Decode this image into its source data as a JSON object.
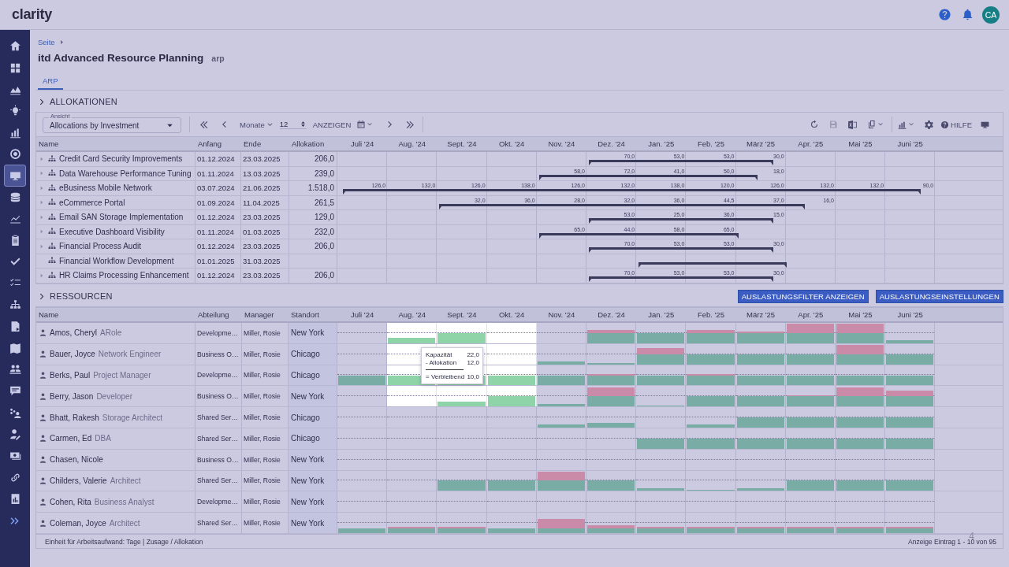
{
  "header": {
    "logo": "clarity",
    "avatar": "CA"
  },
  "sidebar": {
    "items": [
      {
        "selected": false
      },
      {
        "selected": false
      },
      {
        "selected": false
      },
      {
        "selected": false
      },
      {
        "selected": false
      },
      {
        "selected": false
      },
      {
        "selected": true
      },
      {
        "selected": false
      },
      {
        "selected": false
      },
      {
        "selected": false
      },
      {
        "selected": false
      },
      {
        "selected": false
      },
      {
        "selected": false
      },
      {
        "selected": false
      },
      {
        "selected": false
      },
      {
        "selected": false
      },
      {
        "selected": false
      },
      {
        "selected": false
      },
      {
        "selected": false
      },
      {
        "selected": false
      },
      {
        "selected": false
      },
      {
        "selected": false
      },
      {
        "selected": false
      }
    ]
  },
  "breadcrumb": "Seite",
  "title": "itd Advanced Resource Planning",
  "title_tag": "arp",
  "tabs": [
    {
      "label": "ARP",
      "selected": true
    }
  ],
  "allocations": {
    "title": "ALLOKATIONEN",
    "toolbar": {
      "view_label": "Ansicht",
      "view_value": "Allocations by Investment",
      "period": "Monate",
      "count": "12",
      "show": "ANZEIGEN",
      "help": "HILFE"
    },
    "columns": [
      "Name",
      "Anfang",
      "Ende",
      "Allokation"
    ],
    "months": [
      "Juli '24",
      "Aug. '24",
      "Sept. '24",
      "Okt. '24",
      "Nov. '24",
      "Dez. '24",
      "Jan. '25",
      "Feb. '25",
      "März '25",
      "Apr. '25",
      "Mai '25",
      "Juni '25"
    ],
    "rows": [
      {
        "name": "Credit Card Security Improvements",
        "start": "01.12.2024",
        "end": "23.03.2025",
        "allocation": "206,0",
        "expandable": true,
        "values": [
          "70,0",
          "53,0",
          "53,0",
          "30,0"
        ]
      },
      {
        "name": "Data Warehouse Performance Tuning",
        "start": "01.11.2024",
        "end": "13.03.2025",
        "allocation": "239,0",
        "expandable": true,
        "values": [
          "58,0",
          "72,0",
          "41,0",
          "50,0",
          "18,0"
        ]
      },
      {
        "name": "eBusiness Mobile Network",
        "start": "03.07.2024",
        "end": "21.06.2025",
        "allocation": "1.518,0",
        "expandable": true,
        "values": [
          "126,0",
          "132,0",
          "126,0",
          "138,0",
          "126,0",
          "132,0",
          "138,0",
          "120,0",
          "126,0",
          "132,0",
          "132,0",
          "90,0"
        ]
      },
      {
        "name": "eCommerce Portal",
        "start": "01.09.2024",
        "end": "11.04.2025",
        "allocation": "261,5",
        "expandable": true,
        "values": [
          "32,0",
          "36,0",
          "28,0",
          "32,0",
          "36,0",
          "44,5",
          "37,0",
          "16,0"
        ]
      },
      {
        "name": "Email SAN Storage Implementation",
        "start": "01.12.2024",
        "end": "23.03.2025",
        "allocation": "129,0",
        "expandable": true,
        "values": [
          "53,0",
          "25,0",
          "36,0",
          "15,0"
        ]
      },
      {
        "name": "Executive Dashboard Visibility",
        "start": "01.11.2024",
        "end": "01.03.2025",
        "allocation": "232,0",
        "expandable": true,
        "values": [
          "65,0",
          "44,0",
          "58,0",
          "65,0"
        ]
      },
      {
        "name": "Financial Process Audit",
        "start": "01.12.2024",
        "end": "23.03.2025",
        "allocation": "206,0",
        "expandable": true,
        "values": [
          "70,0",
          "53,0",
          "53,0",
          "30,0"
        ]
      },
      {
        "name": "Financial Workflow Development",
        "start": "01.01.2025",
        "end": "31.03.2025",
        "expandable": false
      },
      {
        "name": "HR Claims Processing Enhancement",
        "start": "01.12.2024",
        "end": "23.03.2025",
        "allocation": "206,0",
        "expandable": true,
        "values": [
          "70,0",
          "53,0",
          "53,0",
          "30,0"
        ]
      }
    ]
  },
  "resources": {
    "title": "RESSOURCEN",
    "buttons": [
      "AUSLASTUNGSFILTER ANZEIGEN",
      "AUSLASTUNGSEINSTELLUNGEN"
    ],
    "columns": [
      "Name",
      "Abteilung",
      "Manager",
      "Standort"
    ],
    "months": [
      "Juli '24",
      "Aug. '24",
      "Sept. '24",
      "Okt. '24",
      "Nov. '24",
      "Dez. '24",
      "Jan. '25",
      "Feb. '25",
      "März '25",
      "Apr. '25",
      "Mai '25",
      "Juni '25"
    ],
    "rows": [
      {
        "name": "Amos, Cheryl",
        "role": "ARole",
        "department": "Developme…",
        "manager": "Miller, Rosie",
        "location": "New York",
        "cells": [
          {
            "selected": false
          },
          {
            "selected": true
          },
          {
            "selected": true
          },
          {
            "selected": true
          },
          {
            "selected": false
          },
          {
            "selected": false
          },
          {
            "selected": false
          },
          {
            "selected": false
          },
          {
            "selected": false
          },
          {
            "selected": false
          },
          {
            "selected": false
          },
          {
            "selected": false
          }
        ]
      },
      {
        "name": "Bauer, Joyce",
        "role": "Network Engineer",
        "department": "Business O…",
        "manager": "Miller, Rosie",
        "location": "Chicago",
        "cells": [
          {
            "selected": false
          },
          {
            "selected": true
          },
          {
            "selected": true
          },
          {
            "selected": true
          },
          {
            "selected": false
          },
          {
            "selected": false
          },
          {
            "selected": false
          },
          {
            "selected": false
          },
          {
            "selected": false
          },
          {
            "selected": false
          },
          {
            "selected": false
          },
          {
            "selected": false
          }
        ]
      },
      {
        "name": "Berks, Paul",
        "role": "Project Manager",
        "department": "Developme…",
        "manager": "Miller, Rosie",
        "location": "Chicago",
        "cells": [
          {
            "selected": false
          },
          {
            "selected": true
          },
          {
            "selected": true
          },
          {
            "selected": true
          },
          {
            "selected": false
          },
          {
            "selected": false
          },
          {
            "selected": false
          },
          {
            "selected": false
          },
          {
            "selected": false
          },
          {
            "selected": false
          },
          {
            "selected": false
          },
          {
            "selected": false
          }
        ]
      },
      {
        "name": "Berry, Jason",
        "role": "Developer",
        "department": "Business O…",
        "manager": "Miller, Rosie",
        "location": "New York",
        "cells": [
          {
            "selected": false
          },
          {
            "selected": true
          },
          {
            "selected": true
          },
          {
            "selected": true
          },
          {
            "selected": false
          },
          {
            "selected": false
          },
          {
            "selected": false
          },
          {
            "selected": false
          },
          {
            "selected": false
          },
          {
            "selected": false
          },
          {
            "selected": false
          },
          {
            "selected": false
          }
        ]
      },
      {
        "name": "Bhatt, Rakesh",
        "role": "Storage Architect",
        "department": "Shared Ser…",
        "manager": "Miller, Rosie",
        "location": "Chicago",
        "cells": [
          {
            "selected": false
          },
          {
            "selected": false
          },
          {
            "selected": false
          },
          {
            "selected": false
          },
          {
            "selected": false
          },
          {
            "selected": false
          },
          {
            "selected": false
          },
          {
            "selected": false
          },
          {
            "selected": false
          },
          {
            "selected": false
          },
          {
            "selected": false
          },
          {
            "selected": false
          }
        ]
      },
      {
        "name": "Carmen, Ed",
        "role": "DBA",
        "department": "Shared Ser…",
        "manager": "Miller, Rosie",
        "location": "Chicago",
        "cells": [
          {
            "selected": false
          },
          {
            "selected": false
          },
          {
            "selected": false
          },
          {
            "selected": false
          },
          {
            "selected": false
          },
          {
            "selected": false
          },
          {
            "selected": false
          },
          {
            "selected": false
          },
          {
            "selected": false
          },
          {
            "selected": false
          },
          {
            "selected": false
          },
          {
            "selected": false
          }
        ]
      },
      {
        "name": "Chasen, Nicole",
        "department": "Business O…",
        "manager": "Miller, Rosie",
        "location": "New York",
        "cells": [
          {
            "selected": false
          },
          {
            "selected": false
          },
          {
            "selected": false
          },
          {
            "selected": false
          },
          {
            "selected": false
          },
          {
            "selected": false
          },
          {
            "selected": false
          },
          {
            "selected": false
          },
          {
            "selected": false
          },
          {
            "selected": false
          },
          {
            "selected": false
          },
          {
            "selected": false
          }
        ]
      },
      {
        "name": "Childers, Valerie",
        "role": "Architect",
        "department": "Shared Ser…",
        "manager": "Miller, Rosie",
        "location": "New York",
        "cells": [
          {
            "selected": false
          },
          {
            "selected": false
          },
          {
            "selected": false
          },
          {
            "selected": false
          },
          {
            "selected": false
          },
          {
            "selected": false
          },
          {
            "selected": false
          },
          {
            "selected": false
          },
          {
            "selected": false
          },
          {
            "selected": false
          },
          {
            "selected": false
          },
          {
            "selected": false
          }
        ]
      },
      {
        "name": "Cohen, Rita",
        "role": "Business Analyst",
        "department": "Developme…",
        "manager": "Miller, Rosie",
        "location": "New York",
        "cells": [
          {
            "selected": false
          },
          {
            "selected": false
          },
          {
            "selected": false
          },
          {
            "selected": false
          },
          {
            "selected": false
          },
          {
            "selected": false
          },
          {
            "selected": false
          },
          {
            "selected": false
          },
          {
            "selected": false
          },
          {
            "selected": false
          },
          {
            "selected": false
          },
          {
            "selected": false
          }
        ]
      },
      {
        "name": "Coleman, Joyce",
        "role": "Architect",
        "department": "Shared Ser…",
        "manager": "Miller, Rosie",
        "location": "New York",
        "cells": [
          {
            "selected": false
          },
          {
            "selected": false
          },
          {
            "selected": false
          },
          {
            "selected": false
          },
          {
            "selected": false
          },
          {
            "selected": false
          },
          {
            "selected": false
          },
          {
            "selected": false
          },
          {
            "selected": false
          },
          {
            "selected": false
          },
          {
            "selected": false
          },
          {
            "selected": false
          }
        ]
      }
    ],
    "tooltip": {
      "rows": [
        {
          "label": "Kapazität",
          "value": "22,0"
        },
        {
          "label": "- Allokation",
          "value": "12,0"
        },
        {
          "label": "= Verbleibend",
          "value": "10,0"
        }
      ]
    },
    "footer_left": "Einheit für Arbeitsaufwand: Tage | Zusage / Allokation",
    "footer_right": "Anzeige Eintrag 1 - 10 von 95",
    "corner_mark": "4"
  }
}
